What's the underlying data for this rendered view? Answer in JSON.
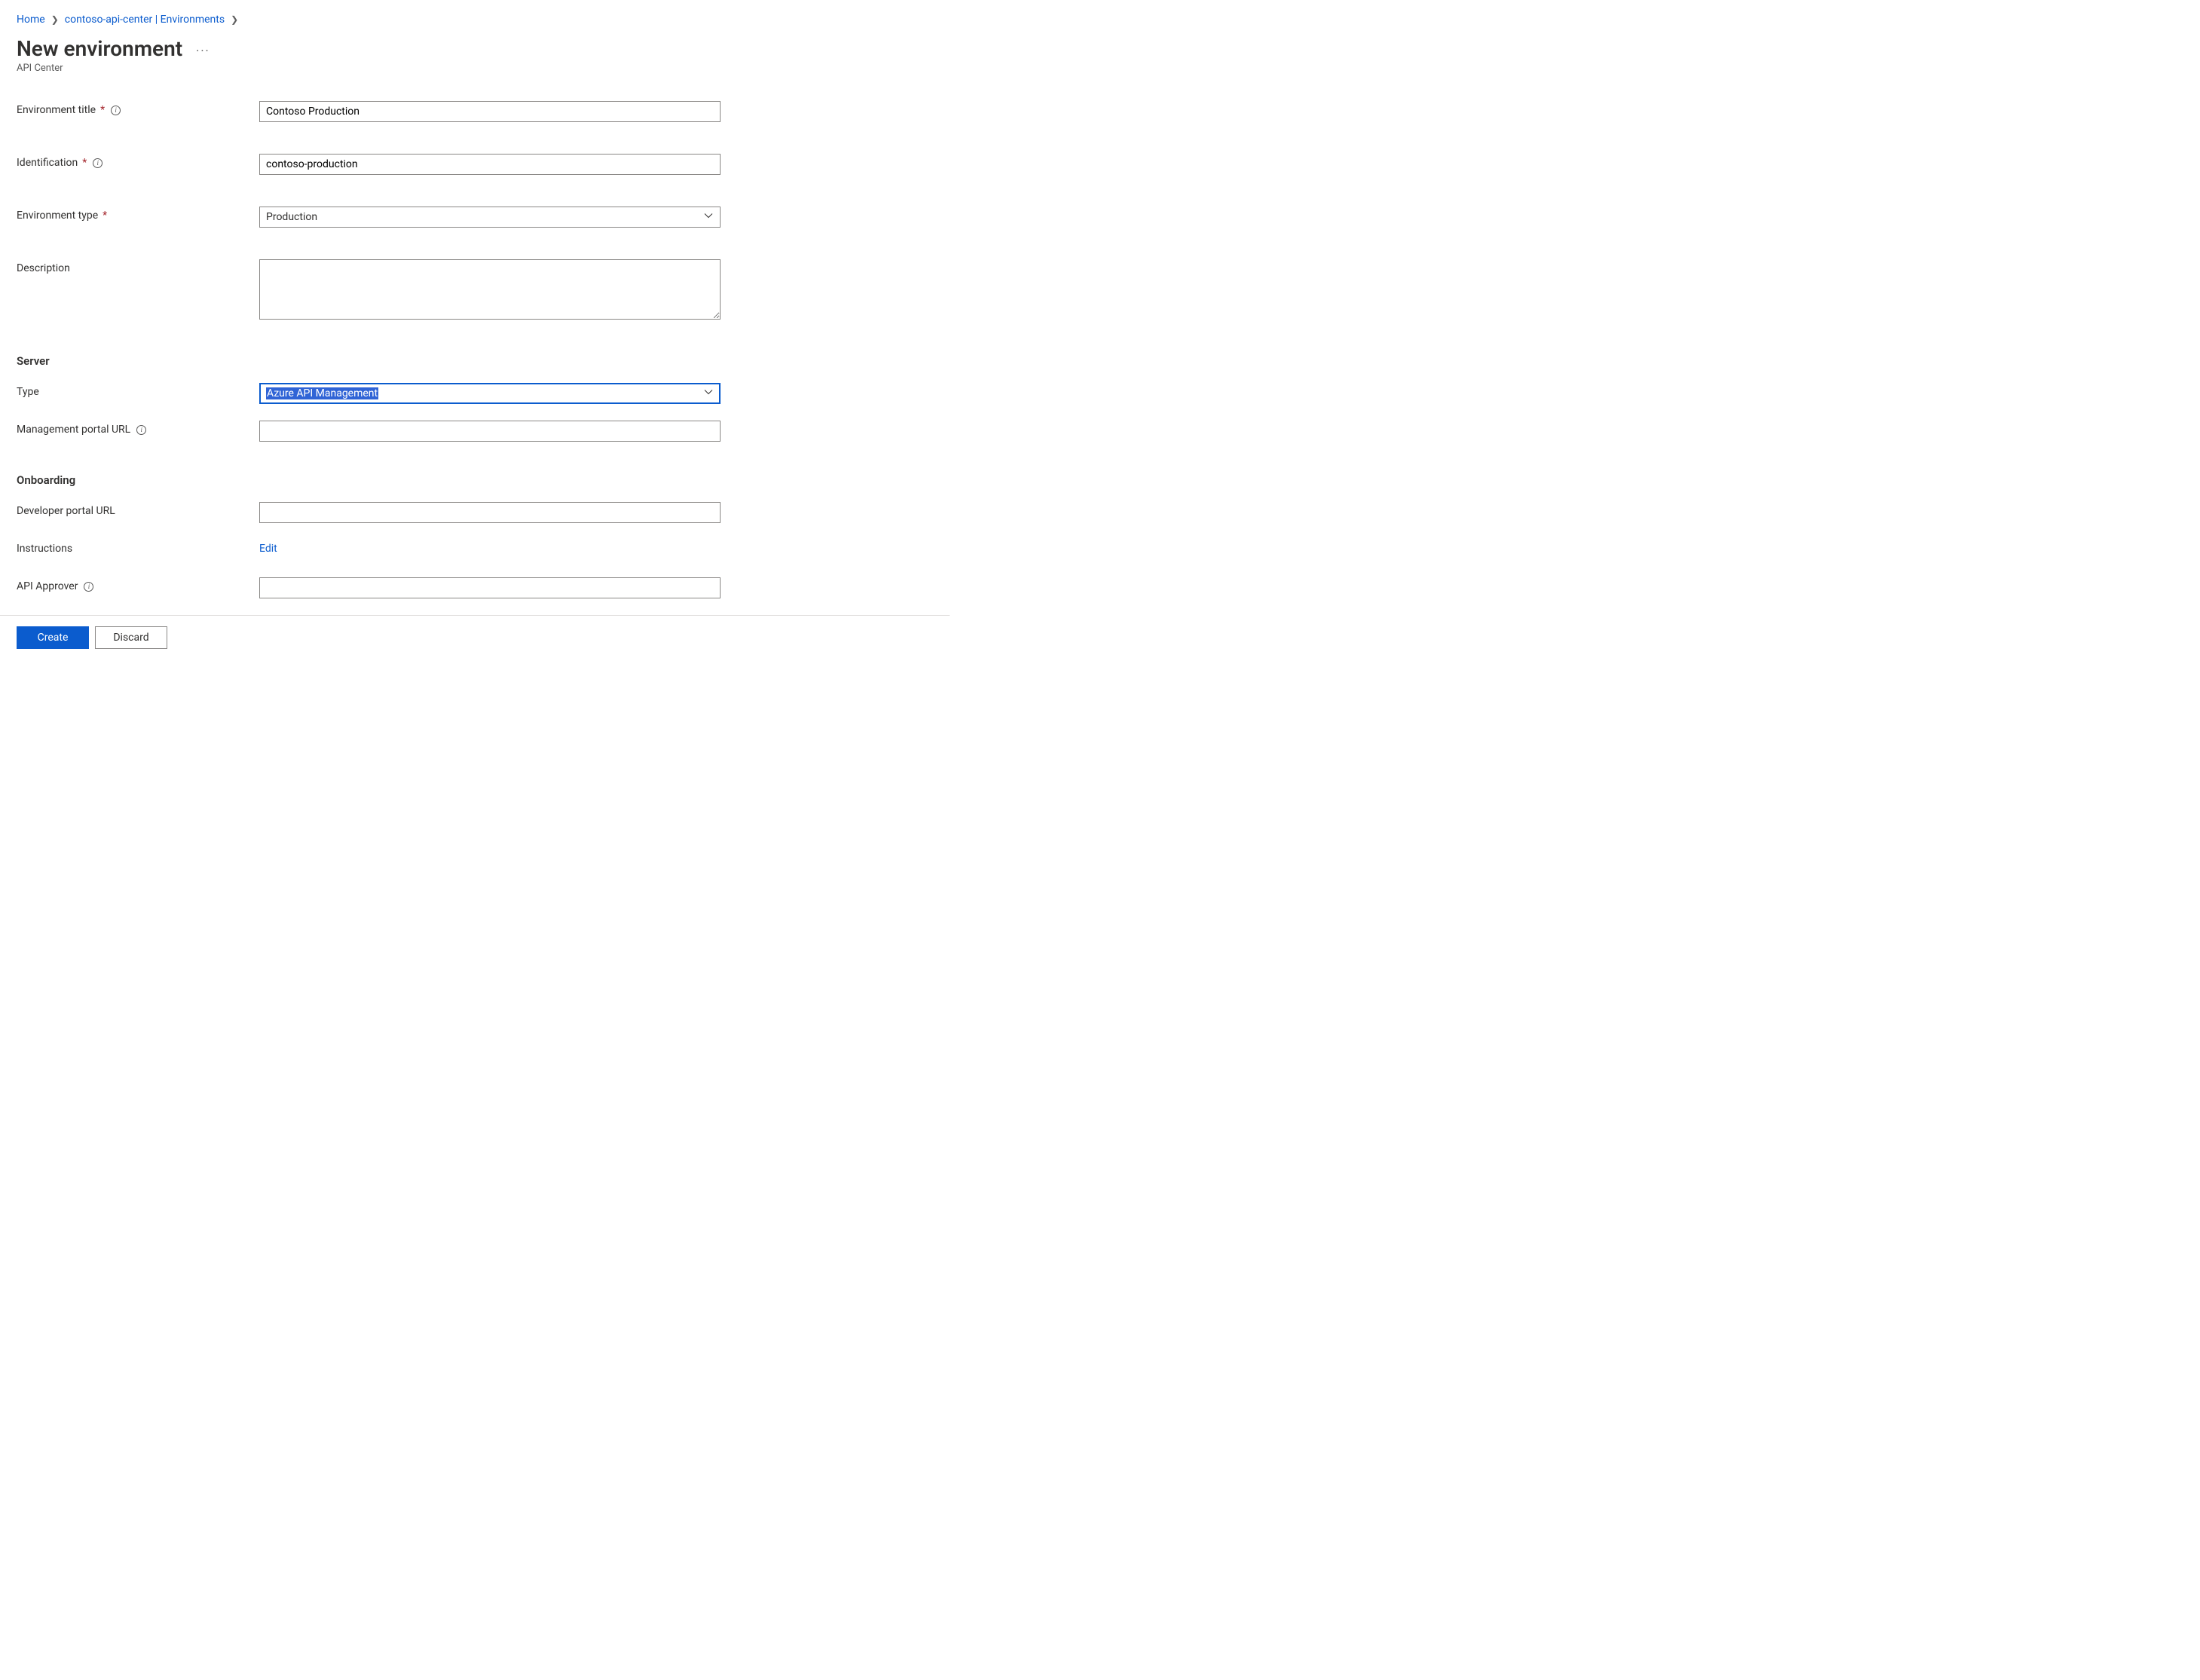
{
  "breadcrumb": {
    "home": "Home",
    "center": "contoso-api-center | Environments"
  },
  "header": {
    "title": "New environment",
    "subtitle": "API Center"
  },
  "form": {
    "env_title_label": "Environment title",
    "env_title_value": "Contoso Production",
    "identification_label": "Identification",
    "identification_value": "contoso-production",
    "env_type_label": "Environment type",
    "env_type_value": "Production",
    "description_label": "Description",
    "description_value": ""
  },
  "server": {
    "heading": "Server",
    "type_label": "Type",
    "type_value": "Azure API Management",
    "mgmt_url_label": "Management portal URL",
    "mgmt_url_value": ""
  },
  "onboarding": {
    "heading": "Onboarding",
    "dev_url_label": "Developer portal URL",
    "dev_url_value": "",
    "instructions_label": "Instructions",
    "instructions_action": "Edit",
    "approver_label": "API Approver",
    "approver_value": ""
  },
  "footer": {
    "create": "Create",
    "discard": "Discard"
  }
}
